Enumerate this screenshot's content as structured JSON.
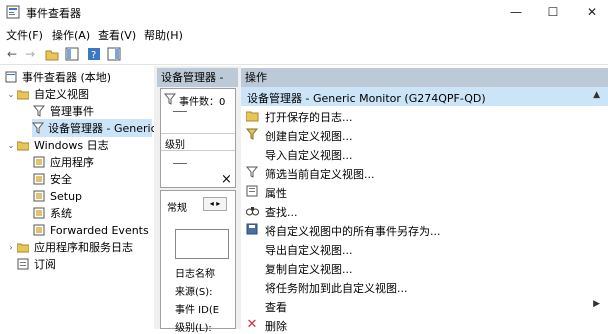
{
  "window": {
    "title": "事件查看器",
    "controls": {
      "minimize": "—",
      "maximize": "☐",
      "close": "✕"
    }
  },
  "menu": [
    "文件(F)",
    "操作(A)",
    "查看(V)",
    "帮助(H)"
  ],
  "tree": {
    "root": "事件查看器 (本地)",
    "custom_views": "自定义视图",
    "admin_events": "管理事件",
    "device_manager": "设备管理器 - Generic",
    "windows_logs": "Windows 日志",
    "application": "应用程序",
    "security": "安全",
    "setup": "Setup",
    "system": "系统",
    "forwarded": "Forwarded Events",
    "apps_services": "应用程序和服务日志",
    "subscriptions": "订阅"
  },
  "middle": {
    "header": "设备管理器 -",
    "event_count_label": "事件数：0",
    "column_level": "级别",
    "close_glyph": "×",
    "tab_general": "常规",
    "field_log_name": "日志名称",
    "field_source": "来源(S):",
    "field_event_id": "事件 ID(E",
    "field_level": "级别(L):"
  },
  "actions": {
    "header": "操作",
    "section_title": "设备管理器 - Generic Monitor (G274QPF-QD)",
    "items": [
      "打开保存的日志...",
      "创建自定义视图...",
      "导入自定义视图...",
      "筛选当前自定义视图...",
      "属性",
      "查找...",
      "将自定义视图中的所有事件另存为...",
      "导出自定义视图...",
      "复制自定义视图...",
      "将任务附加到此自定义视图...",
      "查看",
      "删除"
    ]
  },
  "colors": {
    "pane_header": "#bcc9d6",
    "selection": "#cce4f7",
    "delete_red": "#d03030"
  }
}
